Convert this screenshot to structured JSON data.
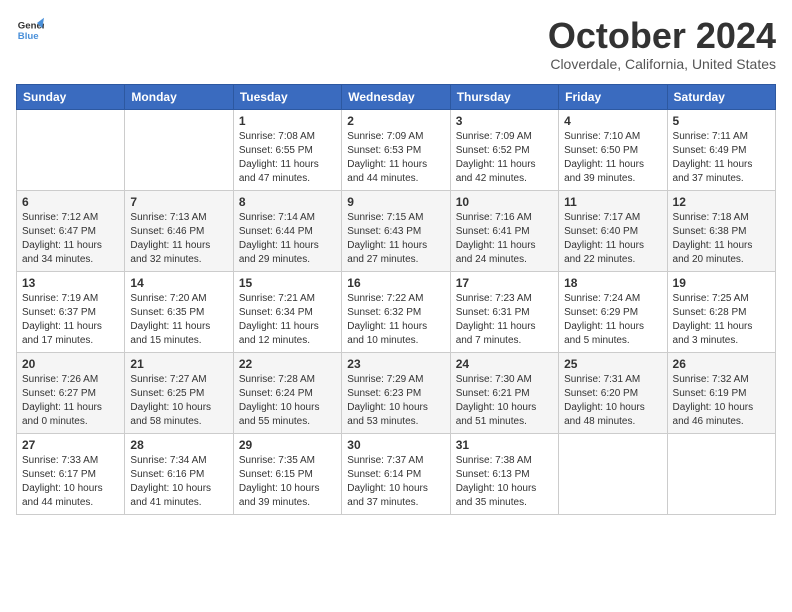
{
  "header": {
    "logo_line1": "General",
    "logo_line2": "Blue",
    "month_title": "October 2024",
    "location": "Cloverdale, California, United States"
  },
  "days_of_week": [
    "Sunday",
    "Monday",
    "Tuesday",
    "Wednesday",
    "Thursday",
    "Friday",
    "Saturday"
  ],
  "weeks": [
    [
      {
        "day": "",
        "info": ""
      },
      {
        "day": "",
        "info": ""
      },
      {
        "day": "1",
        "info": "Sunrise: 7:08 AM\nSunset: 6:55 PM\nDaylight: 11 hours and 47 minutes."
      },
      {
        "day": "2",
        "info": "Sunrise: 7:09 AM\nSunset: 6:53 PM\nDaylight: 11 hours and 44 minutes."
      },
      {
        "day": "3",
        "info": "Sunrise: 7:09 AM\nSunset: 6:52 PM\nDaylight: 11 hours and 42 minutes."
      },
      {
        "day": "4",
        "info": "Sunrise: 7:10 AM\nSunset: 6:50 PM\nDaylight: 11 hours and 39 minutes."
      },
      {
        "day": "5",
        "info": "Sunrise: 7:11 AM\nSunset: 6:49 PM\nDaylight: 11 hours and 37 minutes."
      }
    ],
    [
      {
        "day": "6",
        "info": "Sunrise: 7:12 AM\nSunset: 6:47 PM\nDaylight: 11 hours and 34 minutes."
      },
      {
        "day": "7",
        "info": "Sunrise: 7:13 AM\nSunset: 6:46 PM\nDaylight: 11 hours and 32 minutes."
      },
      {
        "day": "8",
        "info": "Sunrise: 7:14 AM\nSunset: 6:44 PM\nDaylight: 11 hours and 29 minutes."
      },
      {
        "day": "9",
        "info": "Sunrise: 7:15 AM\nSunset: 6:43 PM\nDaylight: 11 hours and 27 minutes."
      },
      {
        "day": "10",
        "info": "Sunrise: 7:16 AM\nSunset: 6:41 PM\nDaylight: 11 hours and 24 minutes."
      },
      {
        "day": "11",
        "info": "Sunrise: 7:17 AM\nSunset: 6:40 PM\nDaylight: 11 hours and 22 minutes."
      },
      {
        "day": "12",
        "info": "Sunrise: 7:18 AM\nSunset: 6:38 PM\nDaylight: 11 hours and 20 minutes."
      }
    ],
    [
      {
        "day": "13",
        "info": "Sunrise: 7:19 AM\nSunset: 6:37 PM\nDaylight: 11 hours and 17 minutes."
      },
      {
        "day": "14",
        "info": "Sunrise: 7:20 AM\nSunset: 6:35 PM\nDaylight: 11 hours and 15 minutes."
      },
      {
        "day": "15",
        "info": "Sunrise: 7:21 AM\nSunset: 6:34 PM\nDaylight: 11 hours and 12 minutes."
      },
      {
        "day": "16",
        "info": "Sunrise: 7:22 AM\nSunset: 6:32 PM\nDaylight: 11 hours and 10 minutes."
      },
      {
        "day": "17",
        "info": "Sunrise: 7:23 AM\nSunset: 6:31 PM\nDaylight: 11 hours and 7 minutes."
      },
      {
        "day": "18",
        "info": "Sunrise: 7:24 AM\nSunset: 6:29 PM\nDaylight: 11 hours and 5 minutes."
      },
      {
        "day": "19",
        "info": "Sunrise: 7:25 AM\nSunset: 6:28 PM\nDaylight: 11 hours and 3 minutes."
      }
    ],
    [
      {
        "day": "20",
        "info": "Sunrise: 7:26 AM\nSunset: 6:27 PM\nDaylight: 11 hours and 0 minutes."
      },
      {
        "day": "21",
        "info": "Sunrise: 7:27 AM\nSunset: 6:25 PM\nDaylight: 10 hours and 58 minutes."
      },
      {
        "day": "22",
        "info": "Sunrise: 7:28 AM\nSunset: 6:24 PM\nDaylight: 10 hours and 55 minutes."
      },
      {
        "day": "23",
        "info": "Sunrise: 7:29 AM\nSunset: 6:23 PM\nDaylight: 10 hours and 53 minutes."
      },
      {
        "day": "24",
        "info": "Sunrise: 7:30 AM\nSunset: 6:21 PM\nDaylight: 10 hours and 51 minutes."
      },
      {
        "day": "25",
        "info": "Sunrise: 7:31 AM\nSunset: 6:20 PM\nDaylight: 10 hours and 48 minutes."
      },
      {
        "day": "26",
        "info": "Sunrise: 7:32 AM\nSunset: 6:19 PM\nDaylight: 10 hours and 46 minutes."
      }
    ],
    [
      {
        "day": "27",
        "info": "Sunrise: 7:33 AM\nSunset: 6:17 PM\nDaylight: 10 hours and 44 minutes."
      },
      {
        "day": "28",
        "info": "Sunrise: 7:34 AM\nSunset: 6:16 PM\nDaylight: 10 hours and 41 minutes."
      },
      {
        "day": "29",
        "info": "Sunrise: 7:35 AM\nSunset: 6:15 PM\nDaylight: 10 hours and 39 minutes."
      },
      {
        "day": "30",
        "info": "Sunrise: 7:37 AM\nSunset: 6:14 PM\nDaylight: 10 hours and 37 minutes."
      },
      {
        "day": "31",
        "info": "Sunrise: 7:38 AM\nSunset: 6:13 PM\nDaylight: 10 hours and 35 minutes."
      },
      {
        "day": "",
        "info": ""
      },
      {
        "day": "",
        "info": ""
      }
    ]
  ]
}
